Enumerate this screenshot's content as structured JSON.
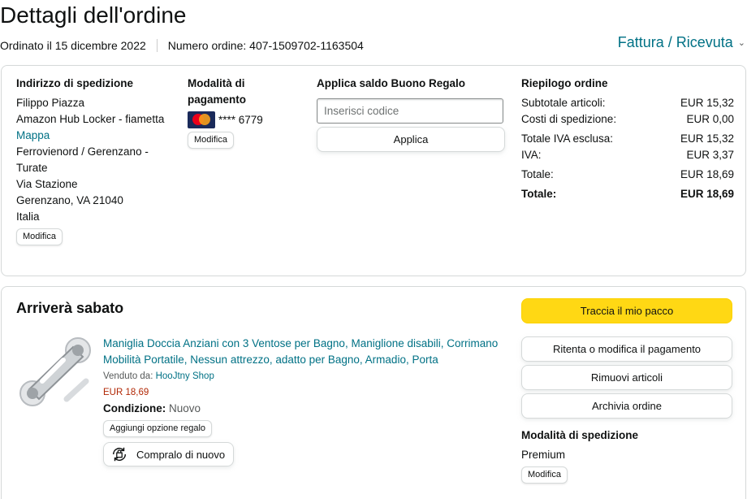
{
  "header": {
    "title": "Dettagli dell'ordine",
    "ordered_on": "Ordinato il 15 dicembre 2022",
    "order_number": "Numero ordine: 407-1509702-1163504",
    "invoice_link": "Fattura / Ricevuta",
    "invoice_chevron": "chevron-down-icon"
  },
  "shipping_address": {
    "title": "Indirizzo di spedizione",
    "name": "Filippo Piazza",
    "line1": "Amazon Hub Locker - fiametta",
    "map_link": "Mappa",
    "line2": "Ferrovienord / Gerenzano -",
    "line3": "Turate",
    "line4": "Via Stazione",
    "line5": "Gerenzano, VA 21040",
    "country": "Italia",
    "edit_label": "Modifica"
  },
  "payment": {
    "title": "Modalità di pagamento",
    "card_icon": "mastercard-icon",
    "card_digits": "**** 6779",
    "edit_label": "Modifica"
  },
  "gift_card": {
    "title": "Applica saldo Buono Regalo",
    "placeholder": "Inserisci codice",
    "apply_label": "Applica"
  },
  "order_summary": {
    "title": "Riepilogo ordine",
    "rows": [
      {
        "label": "Subtotale articoli:",
        "value": "EUR 15,32"
      },
      {
        "label": "Costi di spedizione:",
        "value": "EUR 0,00"
      },
      {
        "label": "Totale IVA esclusa:",
        "value": "EUR 15,32"
      },
      {
        "label": "IVA:",
        "value": "EUR 3,37"
      },
      {
        "label": "Totale:",
        "value": "EUR 18,69"
      },
      {
        "label": "Totale:",
        "value": "EUR 18,69"
      }
    ]
  },
  "shipment": {
    "status": "Arriverà sabato",
    "product": {
      "image_icon": "shower-grab-bar-product-image",
      "title": "Maniglia Doccia Anziani con 3 Ventose per Bagno, Maniglione disabili, Corrimano Mobilità Portatile, Nessun attrezzo, adatto per Bagno, Armadio, Porta",
      "sold_by_label": "Venduto da:",
      "seller": "HooJtny Shop",
      "price": "EUR 18,69",
      "condition_label": "Condizione:",
      "condition_value": "Nuovo",
      "gift_option_label": "Aggiungi opzione regalo",
      "buy_again_label": "Compralo di nuovo",
      "buy_again_icon": "buy-again-icon"
    },
    "actions": {
      "track_label": "Traccia il mio pacco",
      "retry_payment_label": "Ritenta o modifica il pagamento",
      "remove_items_label": "Rimuovi articoli",
      "archive_label": "Archivia ordine"
    },
    "shipping_method": {
      "title": "Modalità di spedizione",
      "value": "Premium",
      "edit_label": "Modifica"
    }
  },
  "colors": {
    "link": "#007185",
    "price": "#b12704",
    "primary_button": "#ffd814",
    "border": "#d5d9d9"
  }
}
